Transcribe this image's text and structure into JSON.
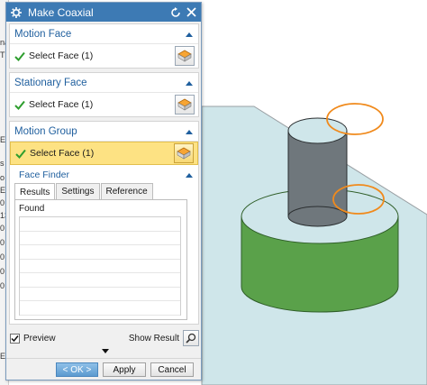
{
  "dialog": {
    "title": "Make Coaxial",
    "icons": {
      "settings": "gear-icon",
      "reset": "reset-icon",
      "close": "close-icon"
    }
  },
  "motion_face": {
    "heading": "Motion Face",
    "select_label": "Select Face (1)"
  },
  "stationary_face": {
    "heading": "Stationary Face",
    "select_label": "Select Face (1)"
  },
  "motion_group": {
    "heading": "Motion Group",
    "select_label": "Select Face (1)"
  },
  "face_finder": {
    "heading": "Face Finder",
    "tabs": [
      "Results",
      "Settings",
      "Reference"
    ],
    "active_tab": "Results",
    "found_label": "Found"
  },
  "preview": {
    "label": "Preview",
    "checked": true,
    "show_result_label": "Show Result"
  },
  "buttons": {
    "ok": "< OK >",
    "apply": "Apply",
    "cancel": "Cancel"
  },
  "side_strip": [
    "na",
    "T",
    "E",
    "s",
    "o",
    "E",
    "0",
    "13",
    "0",
    "0",
    "0",
    "0",
    "0",
    "E"
  ],
  "colors": {
    "titlebar": "#3d7ab4",
    "accent_text": "#1f5f9e",
    "active_row": "#fde283",
    "check": "#2e9e2e",
    "cylinder_green": "#5aa14a",
    "cylinder_grey": "#6f777c",
    "face_highlight": "#cfe6ea",
    "orange_circle": "#f08a1c"
  }
}
